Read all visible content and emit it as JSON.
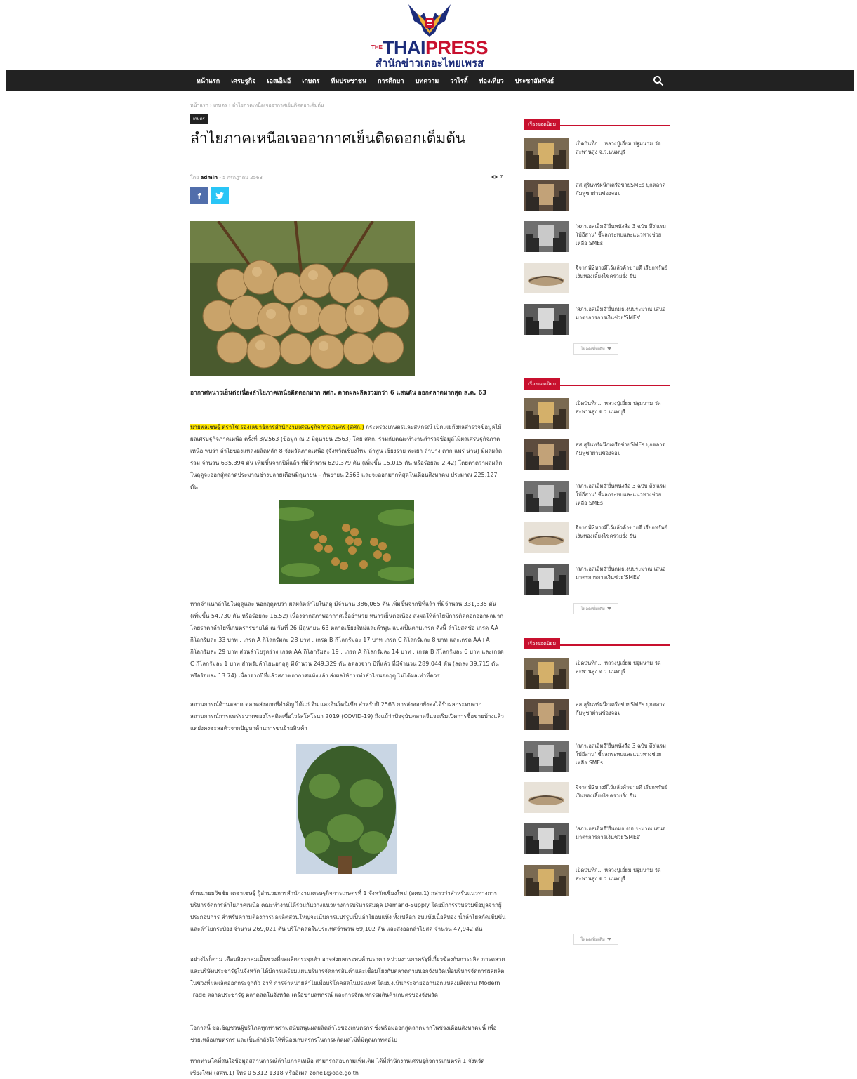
{
  "header": {
    "logo_the": "THE",
    "logo_thai": "THAI",
    "logo_press": "PRESS",
    "logo_sub": "สำนักข่าวเดอะไทยเพรส"
  },
  "nav": {
    "items": [
      "หน้าแรก",
      "เศรษฐกิจ",
      "เอสเอ็มอี",
      "เกษตร",
      "ทีมประชาชน",
      "การศึกษา",
      "บทความ",
      "วาไรตี้",
      "ท่องเที่ยว",
      "ประชาสัมพันธ์"
    ]
  },
  "article": {
    "breadcrumb": "หน้าแรก › เกษตร › ลำไยภาคเหนือเจออากาศเย็นติดดอกเต็มต้น",
    "category": "เกษตร",
    "title": "ลำไยภาคเหนือเจออากาศเย็นติดดอกเต็มต้น",
    "byline_prefix": "โดย",
    "author": "admin",
    "date": "- 5 กรกฎาคม 2563",
    "views": "7",
    "share_fb": "f",
    "share_tw": "t",
    "lead": "อากาศหนาวเย็นต่อเนื่องลำไยภาคเหนือติดดอกมาก สศก. คาดผลผลิตรวมกว่า 6 แสนตัน ออกตลาดมากสุด ส.ค. 63",
    "p1_highlight": "นายพลเชษฐ์ ตราโช รองเลขาธิการสำนักงานเศรษฐกิจการเกษตร (สศก.)",
    "p1_rest": " กระทรวงเกษตรและสหกรณ์ เปิดเผยถึงผลสำรวจข้อมูลไม้ผลเศรษฐกิจภาคเหนือ ครั้งที่ 3/2563 (ข้อมูล ณ 2 มิถุนายน 2563) โดย สศก. ร่วมกับคณะทำงานสำรวจข้อมูลไม้ผลเศรษฐกิจภาคเหนือ พบว่า ลำไยของแหล่งผลิตหลัก 8 จังหวัดภาคเหนือ (จังหวัดเชียงใหม่ ลำพูน เชียงราย พะเยา ลำปาง ตาก แพร่ น่าน) มีผลผลิตรวม จำนวน 635,394 ตัน เพิ่มขึ้นจากปีที่แล้ว ที่มีจำนวน 620,379 ตัน (เพิ่มขึ้น 15,015 ตัน หรือร้อยละ 2.42) โดยคาดว่าผลผลิตในฤดูจะออกสู่ตลาดประมาณช่วงปลายเดือนมิถุนายน – กันยายน 2563 และจะออกมากที่สุดในเดือนสิงหาคม ประมาณ 225,127 ตัน",
    "p2": "หากจำแนกลำไยในฤดูและ นอกฤดูพบว่า ผลผลิตลำไยในฤดู มีจำนวน 386,065 ตัน เพิ่มขึ้นจากปีที่แล้ว ที่มีจำนวน 331,335 ตัน (เพิ่มขึ้น 54,730 ตัน หรือร้อยละ 16.52) เนื่องจากสภาพอากาศเอื้ออำนวย หนาวเย็นต่อเนื่อง ส่งผลให้ลำไยมีการติดดอกออกผลมาก โดยราคาลำไยที่เกษตรกรขายได้ ณ วันที่ 26 มิถุนายน 63 ตลาดเชียงใหม่และลำพูน แบ่งเป็นตามเกรด ดังนี้ ลำไยสดช่อ เกรด AA กิโลกรัมละ 33 บาท , เกรด A กิโลกรัมละ 28 บาท , เกรด B กิโลกรัมละ 17 บาท เกรด C กิโลกรัมละ 8 บาท และเกรด AA+A กิโลกรัมละ 29 บาท ส่วนลำไยรูดร่วง เกรด AA กิโลกรัมละ 19 , เกรด A กิโลกรัมละ 14 บาท , เกรด B กิโลกรัมละ 6 บาท และเกรด C กิโลกรัมละ 1 บาท สำหรับลำไยนอกฤดู มีจำนวน 249,329 ตัน ลดลงจาก ปีที่แล้ว ที่มีจำนวน 289,044 ตัน (ลดลง 39,715 ตัน หรือร้อยละ 13.74) เนื่องจากปีที่แล้วสภาพอากาศแห้งแล้ง ส่งผลให้การทำลำไยนอกฤดู ไม่ได้ผลเท่าที่ควร",
    "p3": "สถานการณ์ด้านตลาด ตลาดส่งออกที่สำคัญ ได้แก่ จีน และอินโดนีเซีย สำหรับปี 2563 การส่งออกยังคงได้รับผลกระทบจากสถานการณ์การแพร่ระบาดของโรคติดเชื้อไวรัสโคโรนา 2019 (COVID-19) ถึงแม้ว่าปัจจุบันตลาดจีนจะเริ่มเปิดการซื้อขายบ้างแล้วแต่ยังคงชะลอตัวจากปัญหาด้านการขนย้ายสินค้า",
    "p4": "ด้านนายธวัชชัย เดชาเชษฐ์ ผู้อำนวยการสำนักงานเศรษฐกิจการเกษตรที่ 1 จังหวัดเชียงใหม่ (สศท.1) กล่าวว่าสำหรับแนวทางการบริหารจัดการลำไยภาคเหนือ คณะทำงานได้ร่วมกันวางแนวทางการบริหารสมดุล Demand-Supply โดยมีการรวบรวมข้อมูลจากผู้ประกอบการ สำหรับความต้องการผลผลิตส่วนใหญ่จะเน้นการแปรรูปเป็นลำไยอบแห้ง ทั้งเปลือก อบแห้งเนื้อสีทอง น้ำลำไยสกัดเข้มข้น และลำไยกระป๋อง จำนวน 269,021 ตัน บริโภคสดในประเทศจำนวน 69,102 ตัน และส่งออกลำไยสด จำนวน 47,942 ตัน",
    "p5": "อย่างไรก็ตาม เดือนสิงหาคมเป็นช่วงที่ผลผลิตกระจุกตัว อาจส่งผลกระทบด้านราคา หน่วยงานภาครัฐที่เกี่ยวข้องกับการผลิต การตลาด และบริษัทประชารัฐในจังหวัด ได้มีการเตรียมแผนบริหารจัดการสินค้าและเชื่อมโยงกับตลาดภายนอกจังหวัดเพื่อบริหารจัดการผลผลิตในช่วงที่ผลผลิตออกกระจุกตัว อาทิ การจำหน่ายลำไยเพื่อบริโภคสดในประเทศ โดยมุ่งเน้นกระจายออกนอกแหล่งผลิตผ่าน Modern Trade ตลาดประชารัฐ ตลาดสดในจังหวัด เครือข่ายสหกรณ์ และการจัดมหกรรมสินค้าเกษตรของจังหวัด",
    "p6": "โอกาสนี้ ขอเชิญชวนผู้บริโภคทุกท่านร่วมสนับสนุนผลผลิตลำไยของเกษตรกร ซึ่งพร้อมออกสู่ตลาดมากในช่วงเดือนสิงหาคมนี้ เพื่อช่วยเหลือเกษตรกร และเป็นกำลังใจให้พี่น้องเกษตรกรในการผลิตผลไม้ที่มีคุณภาพต่อไป",
    "p7": "หากท่านใดที่สนใจข้อมูลสถานการณ์ลำไยภาคเหนือ สามารถสอบถามเพิ่มเติม ได้ที่สำนักงานเศรษฐกิจการเกษตรที่ 1 จังหวัดเชียงใหม่ (สศท.1) โทร 0 5312 1318 หรืออีเมล zone1@oae.go.th"
  },
  "sidebar": {
    "heading": "เรื่องยอดนิยม",
    "more_label": "โหลดเพิ่มเติม",
    "items": [
      "เปิดบันทึก... หลวงปู่เอี่ยม ปฐมนาม วัดสะพานสูง จ.ว.นนทบุรี",
      "สส.สุรินทร์ผนึกเครือข่ายSMEs บุกตลาดกัมพูชาผ่านช่องจอม",
      "'สภาเอสเอ็มอี'ยื่นหนังสือ 3 ฉบับ ถึง'แรมโบ้อีสาน' ชี้ผลกระทบและแนวทางช่วยเหลือ SMEs",
      "จีจากฟ้2หางมีไว้แล้วค้าขายดี เรียกทรัพย์เงินทองเลี้ยงไขครวยยั่ง ยืน",
      "'สภาเอสเอ็มอี'ยื่นกมธ.งบประมาณ เสนอมาตรการการเงินช่วย'SMEs'"
    ],
    "extra_item": "เปิดบันทึก... หลวงปู่เอี่ยม ปฐมนาม วัดสะพานสูง จ.ว.นนทบุรี"
  },
  "colors": {
    "accent": "#c8102e",
    "nav_bg": "#222222",
    "highlight": "#ffe600",
    "facebook": "#516eab",
    "twitter": "#29c5f6"
  }
}
